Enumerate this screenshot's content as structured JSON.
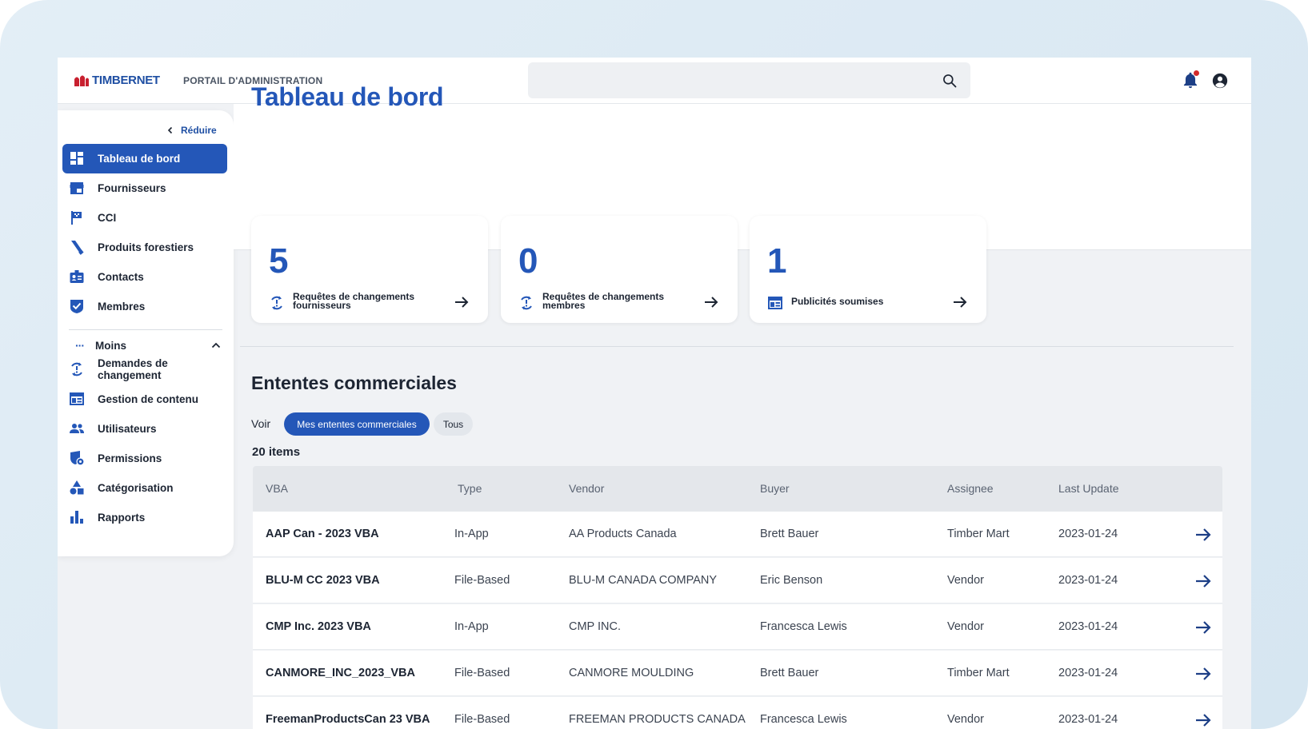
{
  "brand": {
    "logo_text": "TIMBERNET",
    "portal_label": "PORTAIL D'ADMINISTRATION",
    "accent": "#2457b8",
    "logo_red": "#c8202f"
  },
  "search": {
    "placeholder": ""
  },
  "sidebar": {
    "collapse_label": "Réduire",
    "items": [
      {
        "label": "Tableau de bord",
        "icon": "dashboard-icon",
        "active": true
      },
      {
        "label": "Fournisseurs",
        "icon": "store-icon"
      },
      {
        "label": "CCI",
        "icon": "flag-icon"
      },
      {
        "label": "Produits forestiers",
        "icon": "product-icon"
      },
      {
        "label": "Contacts",
        "icon": "contact-card-icon"
      },
      {
        "label": "Membres",
        "icon": "verified-icon"
      }
    ],
    "less_label": "Moins",
    "more_items": [
      {
        "label": "Demandes de changement",
        "icon": "change-request-icon"
      },
      {
        "label": "Gestion de contenu",
        "icon": "content-icon"
      },
      {
        "label": "Utilisateurs",
        "icon": "users-icon"
      },
      {
        "label": "Permissions",
        "icon": "permissions-icon"
      },
      {
        "label": "Catégorisation",
        "icon": "categories-icon"
      },
      {
        "label": "Rapports",
        "icon": "reports-icon"
      }
    ]
  },
  "main": {
    "title": "Tableau de bord",
    "stats": [
      {
        "value": "5",
        "label": "Requêtes de changements fournisseurs",
        "icon": "change-request-icon"
      },
      {
        "value": "0",
        "label": "Requêtes de changements membres",
        "icon": "change-request-icon"
      },
      {
        "value": "1",
        "label": "Publicités soumises",
        "icon": "content-icon"
      }
    ],
    "section_title": "Ententes commerciales",
    "view_label": "Voir",
    "filters": {
      "mine": "Mes ententes commerciales",
      "all": "Tous"
    },
    "item_count": "20 items",
    "table": {
      "headers": [
        "VBA",
        "Type",
        "Vendor",
        "Buyer",
        "Assignee",
        "Last Update"
      ],
      "rows": [
        [
          "AAP Can - 2023 VBA",
          "In-App",
          "AA Products Canada",
          "Brett Bauer",
          "Timber Mart",
          "2023-01-24"
        ],
        [
          "BLU-M CC 2023 VBA",
          "File-Based",
          "BLU-M CANADA COMPANY",
          "Eric Benson",
          "Vendor",
          "2023-01-24"
        ],
        [
          "CMP Inc. 2023 VBA",
          "In-App",
          "CMP INC.",
          "Francesca Lewis",
          "Vendor",
          "2023-01-24"
        ],
        [
          "CANMORE_INC_2023_VBA",
          "File-Based",
          "CANMORE MOULDING",
          "Brett Bauer",
          "Timber Mart",
          "2023-01-24"
        ],
        [
          "FreemanProductsCan 23 VBA",
          "File-Based",
          "FREEMAN PRODUCTS CANADA",
          "Francesca Lewis",
          "Vendor",
          "2023-01-24"
        ]
      ]
    }
  }
}
